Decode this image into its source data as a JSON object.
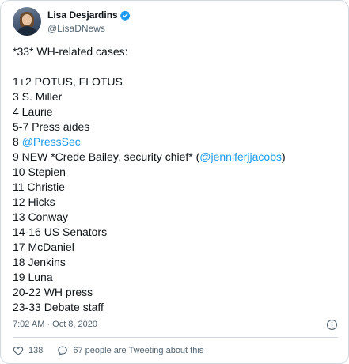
{
  "author": {
    "display_name": "Lisa Desjardins",
    "handle": "@LisaDNews",
    "verified_icon": "verified-badge-icon",
    "avatar_icon": "profile-photo"
  },
  "tweet": {
    "lines": [
      {
        "parts": [
          {
            "text": "*33* WH-related cases:"
          }
        ]
      },
      {
        "parts": [
          {
            "text": ""
          }
        ]
      },
      {
        "parts": [
          {
            "text": "1+2 POTUS, FLOTUS"
          }
        ]
      },
      {
        "parts": [
          {
            "text": "3 S. Miller"
          }
        ]
      },
      {
        "parts": [
          {
            "text": "4 Laurie"
          }
        ]
      },
      {
        "parts": [
          {
            "text": "5-7 Press aides"
          }
        ]
      },
      {
        "parts": [
          {
            "text": "8 "
          },
          {
            "text": "@PressSec",
            "mention": true
          }
        ]
      },
      {
        "parts": [
          {
            "text": "9 NEW *Crede Bailey, security chief* ("
          },
          {
            "text": "@jenniferjjacobs",
            "mention": true
          },
          {
            "text": ")"
          }
        ]
      },
      {
        "parts": [
          {
            "text": "10 Stepien"
          }
        ]
      },
      {
        "parts": [
          {
            "text": "11 Christie"
          }
        ]
      },
      {
        "parts": [
          {
            "text": "12 Hicks"
          }
        ]
      },
      {
        "parts": [
          {
            "text": "13 Conway"
          }
        ]
      },
      {
        "parts": [
          {
            "text": "14-16 US Senators"
          }
        ]
      },
      {
        "parts": [
          {
            "text": "17 McDaniel"
          }
        ]
      },
      {
        "parts": [
          {
            "text": "18 Jenkins"
          }
        ]
      },
      {
        "parts": [
          {
            "text": "19 Luna"
          }
        ]
      },
      {
        "parts": [
          {
            "text": "20-22 WH press"
          }
        ]
      },
      {
        "parts": [
          {
            "text": "23-33 Debate staff"
          }
        ]
      }
    ]
  },
  "meta": {
    "timestamp": "7:02 AM · Oct 8, 2020",
    "info_icon": "info-icon"
  },
  "actions": {
    "like_count": "138",
    "like_icon": "heart-icon",
    "discussion_text": "67 people are Tweeting about this",
    "discussion_icon": "reply-bubble-icon"
  },
  "colors": {
    "text": "#0f1419",
    "secondary": "#536471",
    "link": "#1d9bf0",
    "border": "#cfd9de"
  }
}
